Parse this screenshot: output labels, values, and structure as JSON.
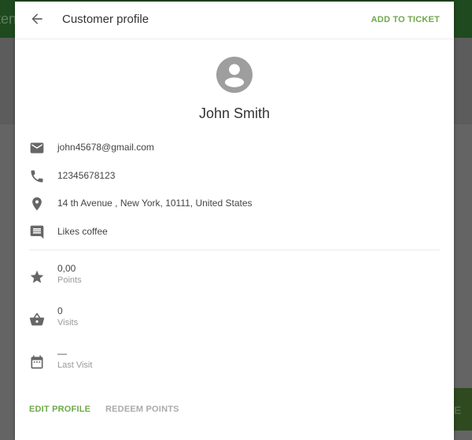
{
  "background": {
    "appbar_partial_text": "ten",
    "button_partial_text": "E"
  },
  "dialog": {
    "title": "Customer profile",
    "back_icon": "arrow-left-icon",
    "action_label": "ADD TO TICKET",
    "accent_color": "#6fa84b"
  },
  "customer": {
    "name": "John Smith",
    "avatar_icon": "account-circle-icon",
    "details": [
      {
        "icon": "email-icon",
        "value": "john45678@gmail.com"
      },
      {
        "icon": "phone-icon",
        "value": "12345678123"
      },
      {
        "icon": "location-icon",
        "value": "14 th Avenue , New York, 10111, United States"
      },
      {
        "icon": "comment-icon",
        "value": "Likes coffee"
      }
    ],
    "stats": [
      {
        "icon": "star-icon",
        "value": "0,00",
        "label": "Points"
      },
      {
        "icon": "basket-icon",
        "value": "0",
        "label": "Visits"
      },
      {
        "icon": "calendar-icon",
        "value": "—",
        "label": "Last Visit"
      }
    ]
  },
  "footer": {
    "edit_label": "EDIT PROFILE",
    "redeem_label": "REDEEM POINTS"
  }
}
